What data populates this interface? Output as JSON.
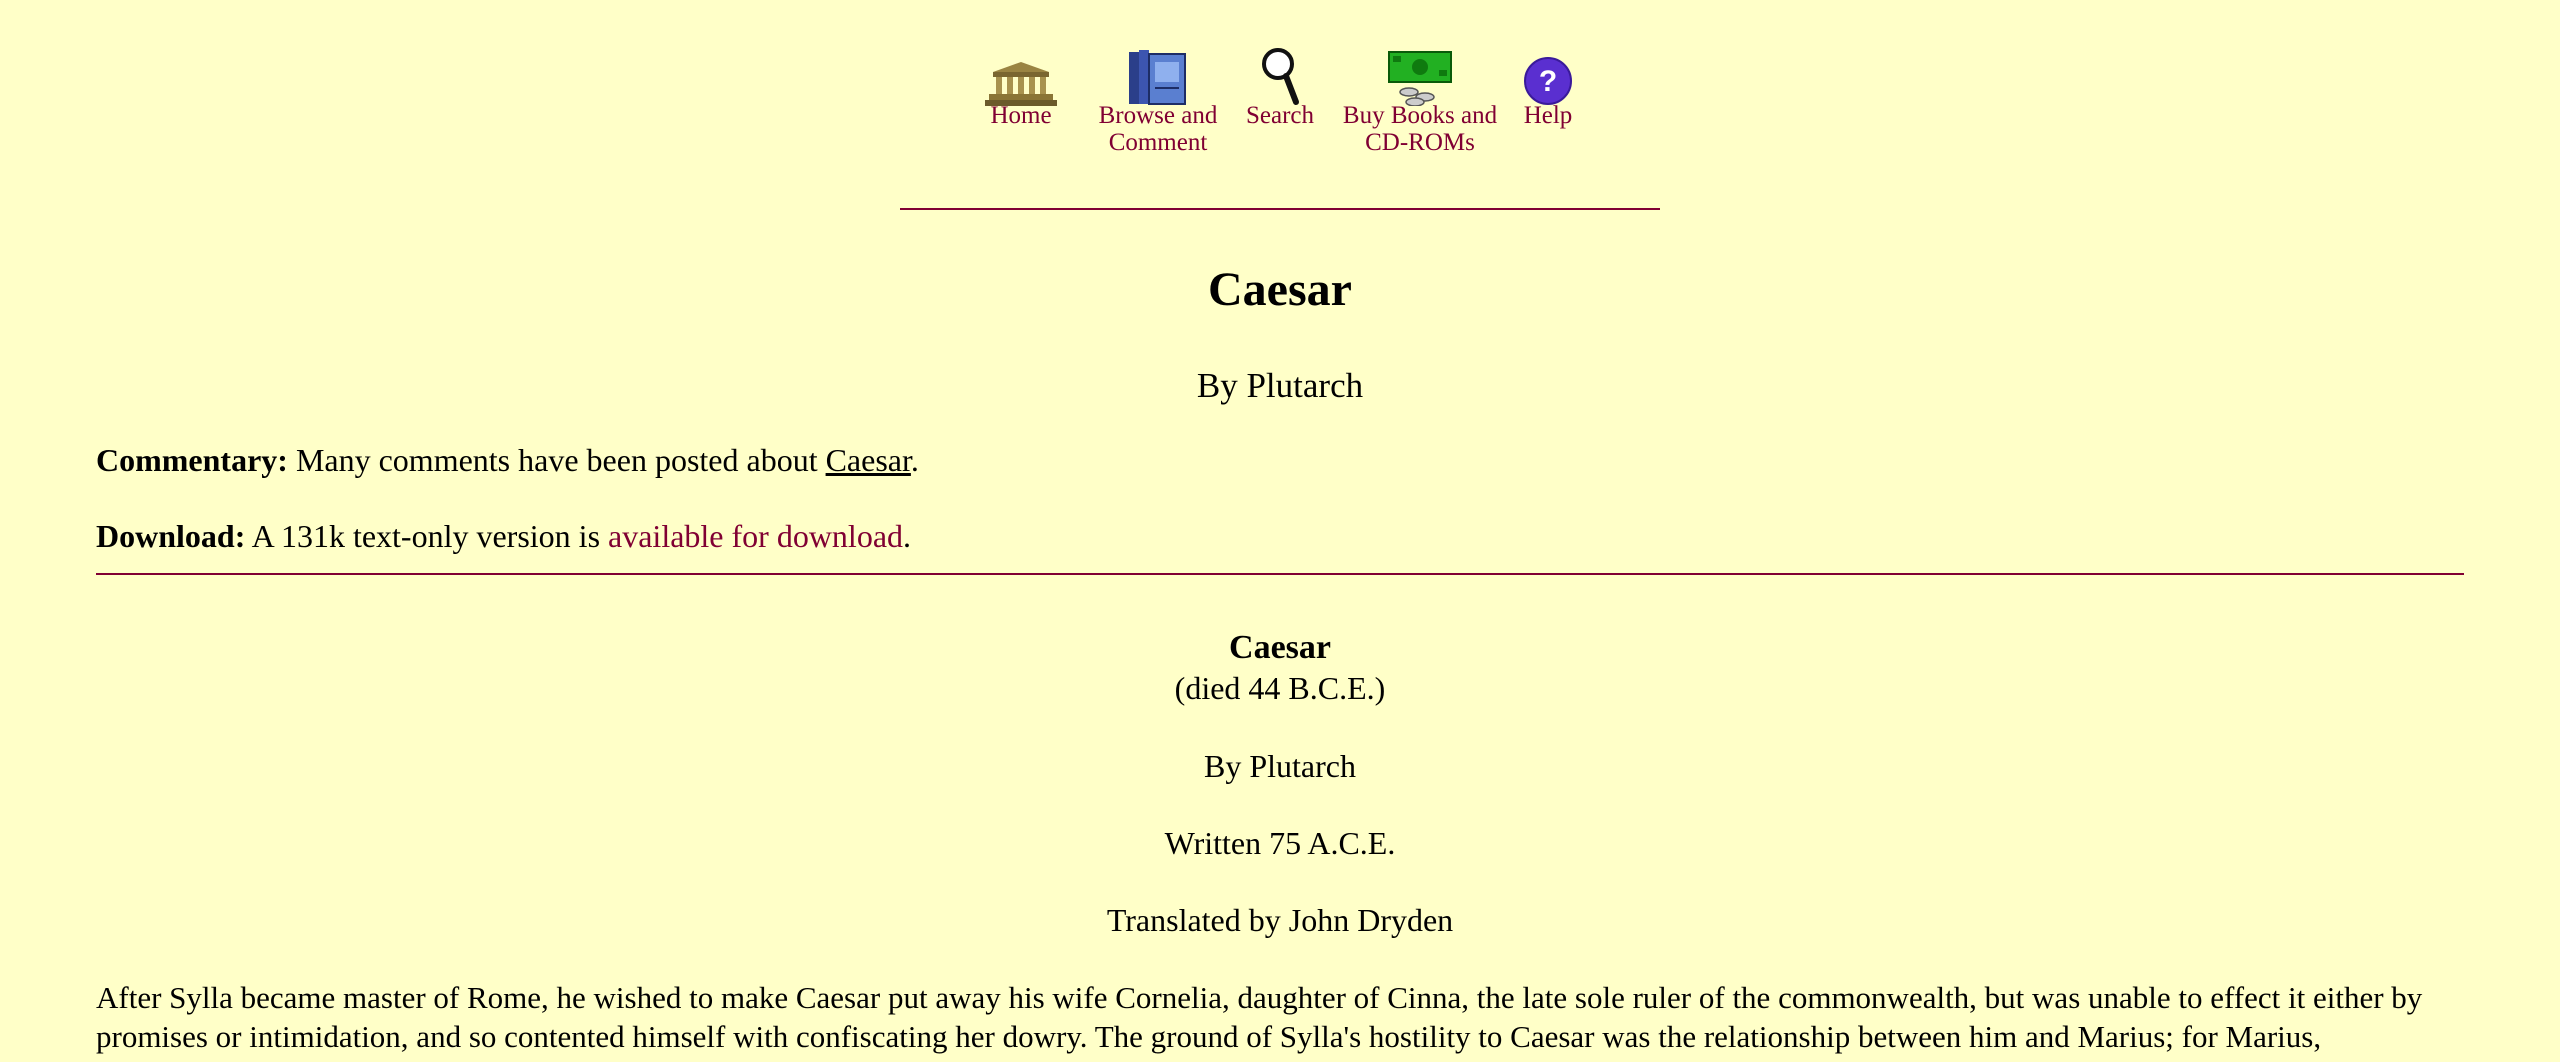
{
  "nav": {
    "items": [
      {
        "label_line1": "Home",
        "label_line2": "",
        "icon": "parthenon-icon"
      },
      {
        "label_line1": "Browse and",
        "label_line2": "Comment",
        "icon": "book-icon"
      },
      {
        "label_line1": "Search",
        "label_line2": "",
        "icon": "magnifier-icon"
      },
      {
        "label_line1": "Buy Books and",
        "label_line2": "CD-ROMs",
        "icon": "money-icon"
      },
      {
        "label_line1": "Help",
        "label_line2": "",
        "icon": "question-icon"
      }
    ]
  },
  "header": {
    "title": "Caesar",
    "byline": "By Plutarch"
  },
  "commentary": {
    "label": "Commentary:",
    "text_before": "Many comments have been posted about",
    "link": "Caesar",
    "text_after": "."
  },
  "download": {
    "label": "Download:",
    "text_before": "A 131k text-only version is",
    "link": "available for download",
    "text_after": "."
  },
  "work": {
    "title": "Caesar",
    "died": "(died 44 B.C.E.)",
    "byline": "By Plutarch",
    "written": "Written 75 A.C.E.",
    "translated": "Translated by John Dryden",
    "body": "After Sylla became master of Rome, he wished to make Caesar put away his wife Cornelia, daughter of Cinna, the late sole ruler of the commonwealth, but was unable to effect it either by promises or intimidation, and so contented himself with confiscating her dowry. The ground of Sylla's hostility to Caesar was the relationship between him and Marius; for Marius,"
  },
  "colors": {
    "background": "#ffffc8",
    "link": "#800033"
  }
}
